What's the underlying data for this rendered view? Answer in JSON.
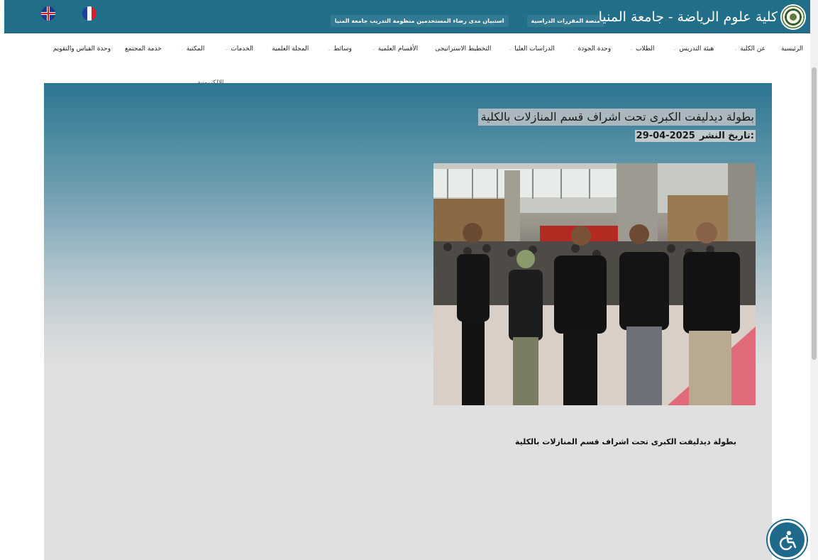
{
  "header": {
    "title": "كلية علوم الرياضة - جامعة المنيا",
    "links": [
      "منصة المقررات الدراسية",
      "استبيان مدى رضاء المستخدمين منظومة التدريب جامعة المنيا"
    ],
    "languages": [
      "English",
      "Français"
    ]
  },
  "nav": {
    "items": [
      {
        "label": "الرئيسية",
        "dropdown": false
      },
      {
        "label": "عن الكلية",
        "dropdown": true
      },
      {
        "label": "هيئة التدريس",
        "dropdown": true
      },
      {
        "label": "الطلاب",
        "dropdown": true
      },
      {
        "label": "وحدة الجودة",
        "dropdown": true
      },
      {
        "label": "الدراسات العليا",
        "dropdown": true
      },
      {
        "label": "التخطيط الاستراتيجى",
        "dropdown": false
      },
      {
        "label": "الأقسام العلمية",
        "dropdown": true
      },
      {
        "label": "وسائط",
        "dropdown": true
      },
      {
        "label": "المجلة العلمية",
        "dropdown": false
      },
      {
        "label": "الخدمات",
        "dropdown": true
      },
      {
        "label": "المكتبة",
        "dropdown": true
      },
      {
        "label": "خدمة المجتمع",
        "dropdown": false
      },
      {
        "label": "وحدة القياس والتقويم",
        "dropdown": false
      }
    ],
    "overflow_item": "الالكترونية"
  },
  "post": {
    "title": "بطولة ديدليفت الكبرى تحت اشراف قسم المنازلات بالكلية",
    "date_label": "تاريخ النشر:",
    "date_value": "29-04-2025",
    "caption": "بطولة ديدليفت الكبرى تحت اشراف قسم المنازلات بالكلية"
  },
  "colors": {
    "header_bg": "#1f6f86",
    "accent": "#1f6a8a"
  },
  "icons": {
    "accessibility": "wheelchair-icon"
  }
}
